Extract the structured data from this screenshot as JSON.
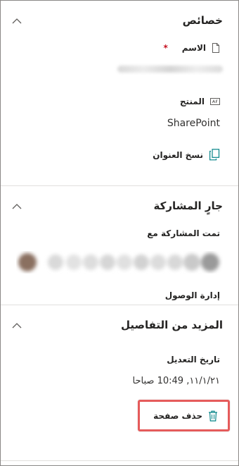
{
  "properties": {
    "title": "خصائص",
    "name_label": "الاسم",
    "required_marker": "*",
    "product_label": "المنتج",
    "product_value": "SharePoint",
    "copy_title_label": "نسخ العنوان"
  },
  "sharing": {
    "title": "جارٍ المشاركة",
    "shared_with_label": "تمت المشاركة مع",
    "manage_access_label": "إدارة الوصول"
  },
  "details": {
    "title": "المزيد من التفاصيل",
    "modified_label": "تاريخ التعديل",
    "modified_value": "١١/١/٢١, 10:49 صباحا",
    "delete_page_label": "حذف صفحة"
  },
  "colors": {
    "accent": "#038387",
    "highlight_border": "#e55b5b",
    "required": "#c50f1f"
  }
}
